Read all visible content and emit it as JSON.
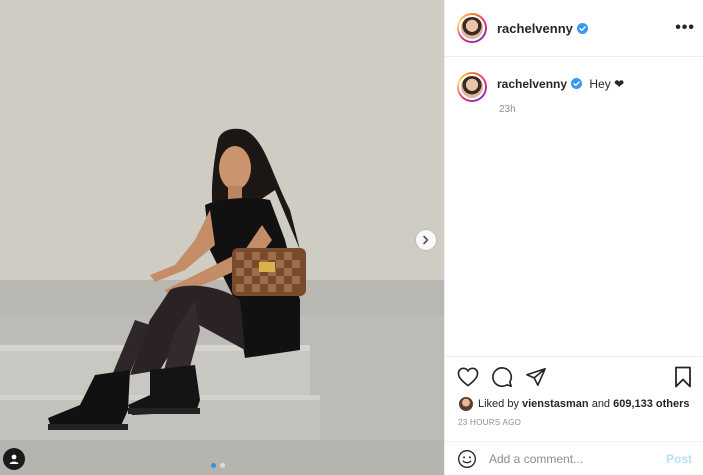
{
  "post": {
    "username": "rachelvenny",
    "caption_username": "rachelvenny",
    "caption_text": "Hey ❤",
    "caption_time": "23h",
    "likes_prefix": "Liked by ",
    "likes_user": "vienstasman",
    "likes_middle": " and ",
    "likes_count": "609,133 others",
    "posted_time": "23 HOURS AGO",
    "more_label": "•••"
  },
  "carousel": {
    "total_slides": 2,
    "active_slide": 1
  },
  "comment": {
    "placeholder": "Add a comment...",
    "post_label": "Post"
  },
  "colors": {
    "verified": "#3897f0",
    "post_disabled": "#b2dffc",
    "dot_active": "#3b8fe0"
  },
  "icons": [
    "verified-badge-icon",
    "more-options-icon",
    "heart-icon",
    "comment-icon",
    "share-icon",
    "bookmark-icon",
    "emoji-icon",
    "chevron-right-icon",
    "user-tag-icon"
  ]
}
